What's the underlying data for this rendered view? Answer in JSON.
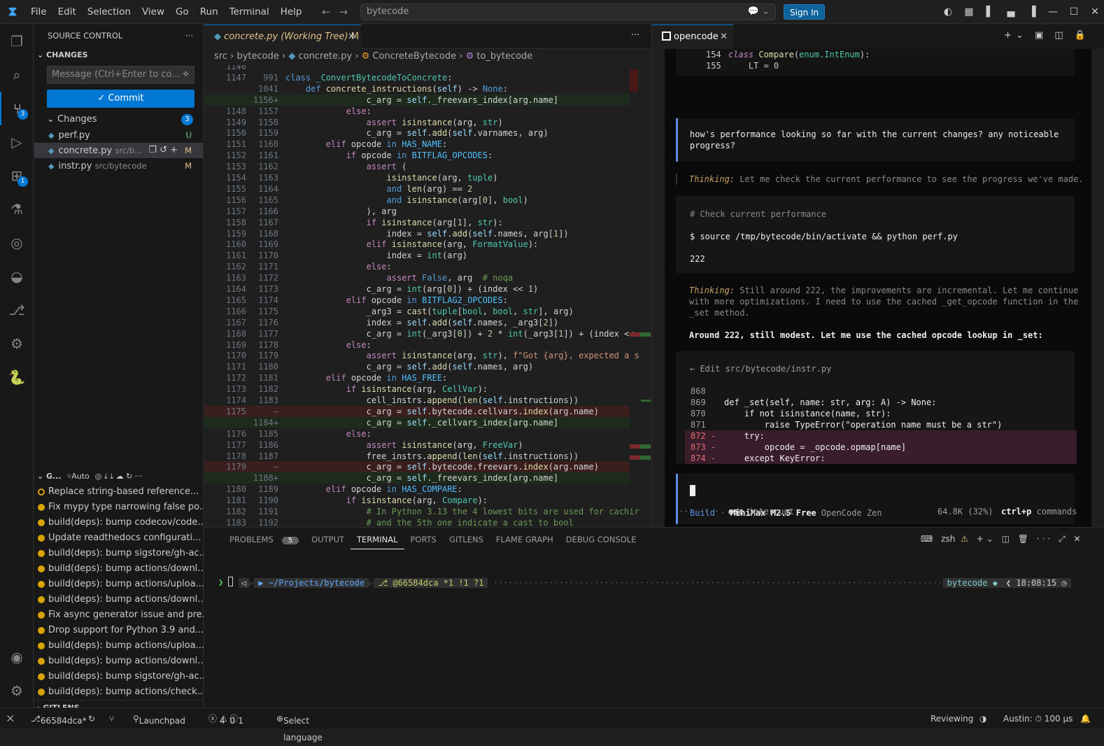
{
  "menu": [
    "File",
    "Edit",
    "Selection",
    "View",
    "Go",
    "Run",
    "Terminal",
    "Help"
  ],
  "search": "bytecode",
  "signin": "Sign In",
  "scm": {
    "title": "SOURCE CONTROL",
    "changes_section": "CHANGES",
    "message_placeholder": "Message (Ctrl+Enter to co...",
    "commit": "✓ Commit",
    "changes_label": "Changes",
    "changes_count": "3",
    "files": [
      {
        "name": "perf.py",
        "dir": "",
        "status": "U"
      },
      {
        "name": "concrete.py",
        "dir": "src/b...",
        "status": "M"
      },
      {
        "name": "instr.py",
        "dir": "src/bytecode",
        "status": "M"
      }
    ]
  },
  "gitlens": {
    "header": "G...",
    "auto": "Auto",
    "footer": "GITLENS",
    "commits": [
      "Replace string-based reference...",
      "Fix mypy type narrowing false po...",
      "build(deps): bump codecov/code...",
      "Update readthedocs configurati...",
      "build(deps): bump sigstore/gh-ac...",
      "build(deps): bump actions/downl...",
      "build(deps): bump actions/uploa...",
      "build(deps): bump actions/downl...",
      "Fix async generator issue and pre...",
      "Drop support for Python 3.9  and...",
      "build(deps): bump actions/uploa...",
      "build(deps): bump actions/downl...",
      "build(deps): bump sigstore/gh-ac...",
      "build(deps): bump actions/check..."
    ]
  },
  "editor": {
    "tab": "concrete.py (Working Tree)",
    "tab_status": "M",
    "breadcrumb": [
      "src",
      "bytecode",
      "concrete.py",
      "ConcreteBytecode",
      "to_bytecode"
    ]
  },
  "opencode": {
    "tab": "opencode",
    "code_top": [
      {
        "n": "154",
        "t": "class Compare(enum.IntEnum):"
      },
      {
        "n": "155",
        "t": "    LT = 0"
      }
    ],
    "user_msg": [
      "how's performance looking so far with the current changes? any noticeable",
      "progress?"
    ],
    "thinking1": "Let me check the current performance to see the progress we've made.",
    "thinking_label": "Thinking:",
    "cmd_comment": "# Check current performance",
    "cmd": "$ source /tmp/bytecode/bin/activate && python perf.py",
    "cmd_out": "222",
    "thinking2": [
      "Still around 222, the improvements are incremental. Let me continue",
      "with more optimizations. I need to use the cached _get_opcode function in the",
      "_set method."
    ],
    "reply": "Around 222, still modest. Let me use the cached opcode lookup in _set:",
    "edit_title": "← Edit src/bytecode/instr.py",
    "edit_lines": [
      {
        "n": "868",
        "m": "",
        "t": ""
      },
      {
        "n": "869",
        "m": "",
        "t": "def _set(self, name: str, arg: A) -> None:"
      },
      {
        "n": "870",
        "m": "",
        "t": "    if not isinstance(name, str):"
      },
      {
        "n": "871",
        "m": "",
        "t": "        raise TypeError(\"operation name must be a str\")"
      },
      {
        "n": "872",
        "m": "-",
        "t": "    try:"
      },
      {
        "n": "873",
        "m": "-",
        "t": "        opcode = _opcode.opmap[name]"
      },
      {
        "n": "874",
        "m": "-",
        "t": "    except KeyError:"
      }
    ],
    "mode": "Build",
    "model": "MiniMax M2.5 Free",
    "provider": "OpenCode Zen",
    "footer_left": "esc interrupt",
    "footer_tokens": "64.8K (32%)",
    "footer_right": "ctrl+p commands"
  },
  "panel": {
    "tabs": [
      "PROBLEMS",
      "OUTPUT",
      "TERMINAL",
      "PORTS",
      "GITLENS",
      "FLAME GRAPH",
      "DEBUG CONSOLE"
    ],
    "problems_count": "5",
    "shell": "zsh",
    "prompt_path": "~/Projects/bytecode",
    "prompt_git": "@66584dca *1 !1 ?1",
    "prompt_right": "bytecode",
    "prompt_time": "18:08:15"
  },
  "status": {
    "branch": "66584dca*",
    "launchpad": "Launchpad",
    "errors": "4",
    "warnings": "0",
    "info": "1",
    "language": "Select language",
    "reviewing": "Reviewing",
    "austin": "Austin: ⏱ 100 μs"
  }
}
